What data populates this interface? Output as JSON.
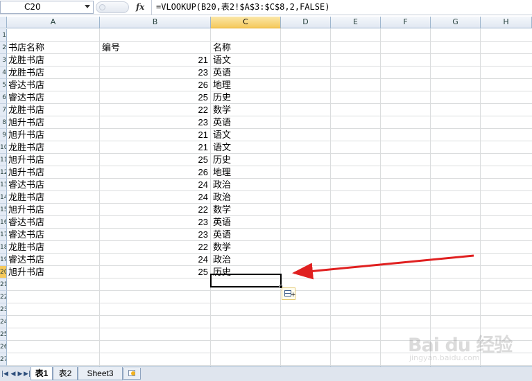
{
  "formula_bar": {
    "name_box": "C20",
    "fx_label": "fx",
    "formula": "=VLOOKUP(B20,表2!$A$3:$C$8,2,FALSE)"
  },
  "columns": [
    "A",
    "B",
    "C",
    "D",
    "E",
    "F",
    "G",
    "H"
  ],
  "selected_column": "C",
  "header_row": {
    "a": "书店名称",
    "b": "编号",
    "c": "名称"
  },
  "rows": [
    {
      "a": "龙胜书店",
      "b": "21",
      "c": "语文"
    },
    {
      "a": "龙胜书店",
      "b": "23",
      "c": "英语"
    },
    {
      "a": "睿达书店",
      "b": "26",
      "c": "地理"
    },
    {
      "a": "睿达书店",
      "b": "25",
      "c": "历史"
    },
    {
      "a": "龙胜书店",
      "b": "22",
      "c": "数学"
    },
    {
      "a": "旭升书店",
      "b": "23",
      "c": "英语"
    },
    {
      "a": "旭升书店",
      "b": "21",
      "c": "语文"
    },
    {
      "a": "龙胜书店",
      "b": "21",
      "c": "语文"
    },
    {
      "a": "旭升书店",
      "b": "25",
      "c": "历史"
    },
    {
      "a": "旭升书店",
      "b": "26",
      "c": "地理"
    },
    {
      "a": "睿达书店",
      "b": "24",
      "c": "政治"
    },
    {
      "a": "龙胜书店",
      "b": "24",
      "c": "政治"
    },
    {
      "a": "旭升书店",
      "b": "22",
      "c": "数学"
    },
    {
      "a": "睿达书店",
      "b": "23",
      "c": "英语"
    },
    {
      "a": "睿达书店",
      "b": "23",
      "c": "英语"
    },
    {
      "a": "龙胜书店",
      "b": "22",
      "c": "数学"
    },
    {
      "a": "睿达书店",
      "b": "24",
      "c": "政治"
    },
    {
      "a": "旭升书店",
      "b": "25",
      "c": "历史"
    }
  ],
  "row_numbers": [
    "1",
    "2",
    "3",
    "4",
    "5",
    "6",
    "7",
    "8",
    "9",
    "10",
    "11",
    "12",
    "13",
    "14",
    "15",
    "16",
    "17",
    "18",
    "19",
    "20",
    "21",
    "22",
    "23",
    "24",
    "25",
    "26",
    "27"
  ],
  "sheet_tabs": [
    {
      "label": "表1",
      "active": true
    },
    {
      "label": "表2",
      "active": false
    },
    {
      "label": "Sheet3",
      "active": false
    }
  ],
  "annotation_arrow_color": "#e02020",
  "watermark": {
    "main": "Bai du 经验",
    "sub": "jingyan.baidu.com"
  }
}
